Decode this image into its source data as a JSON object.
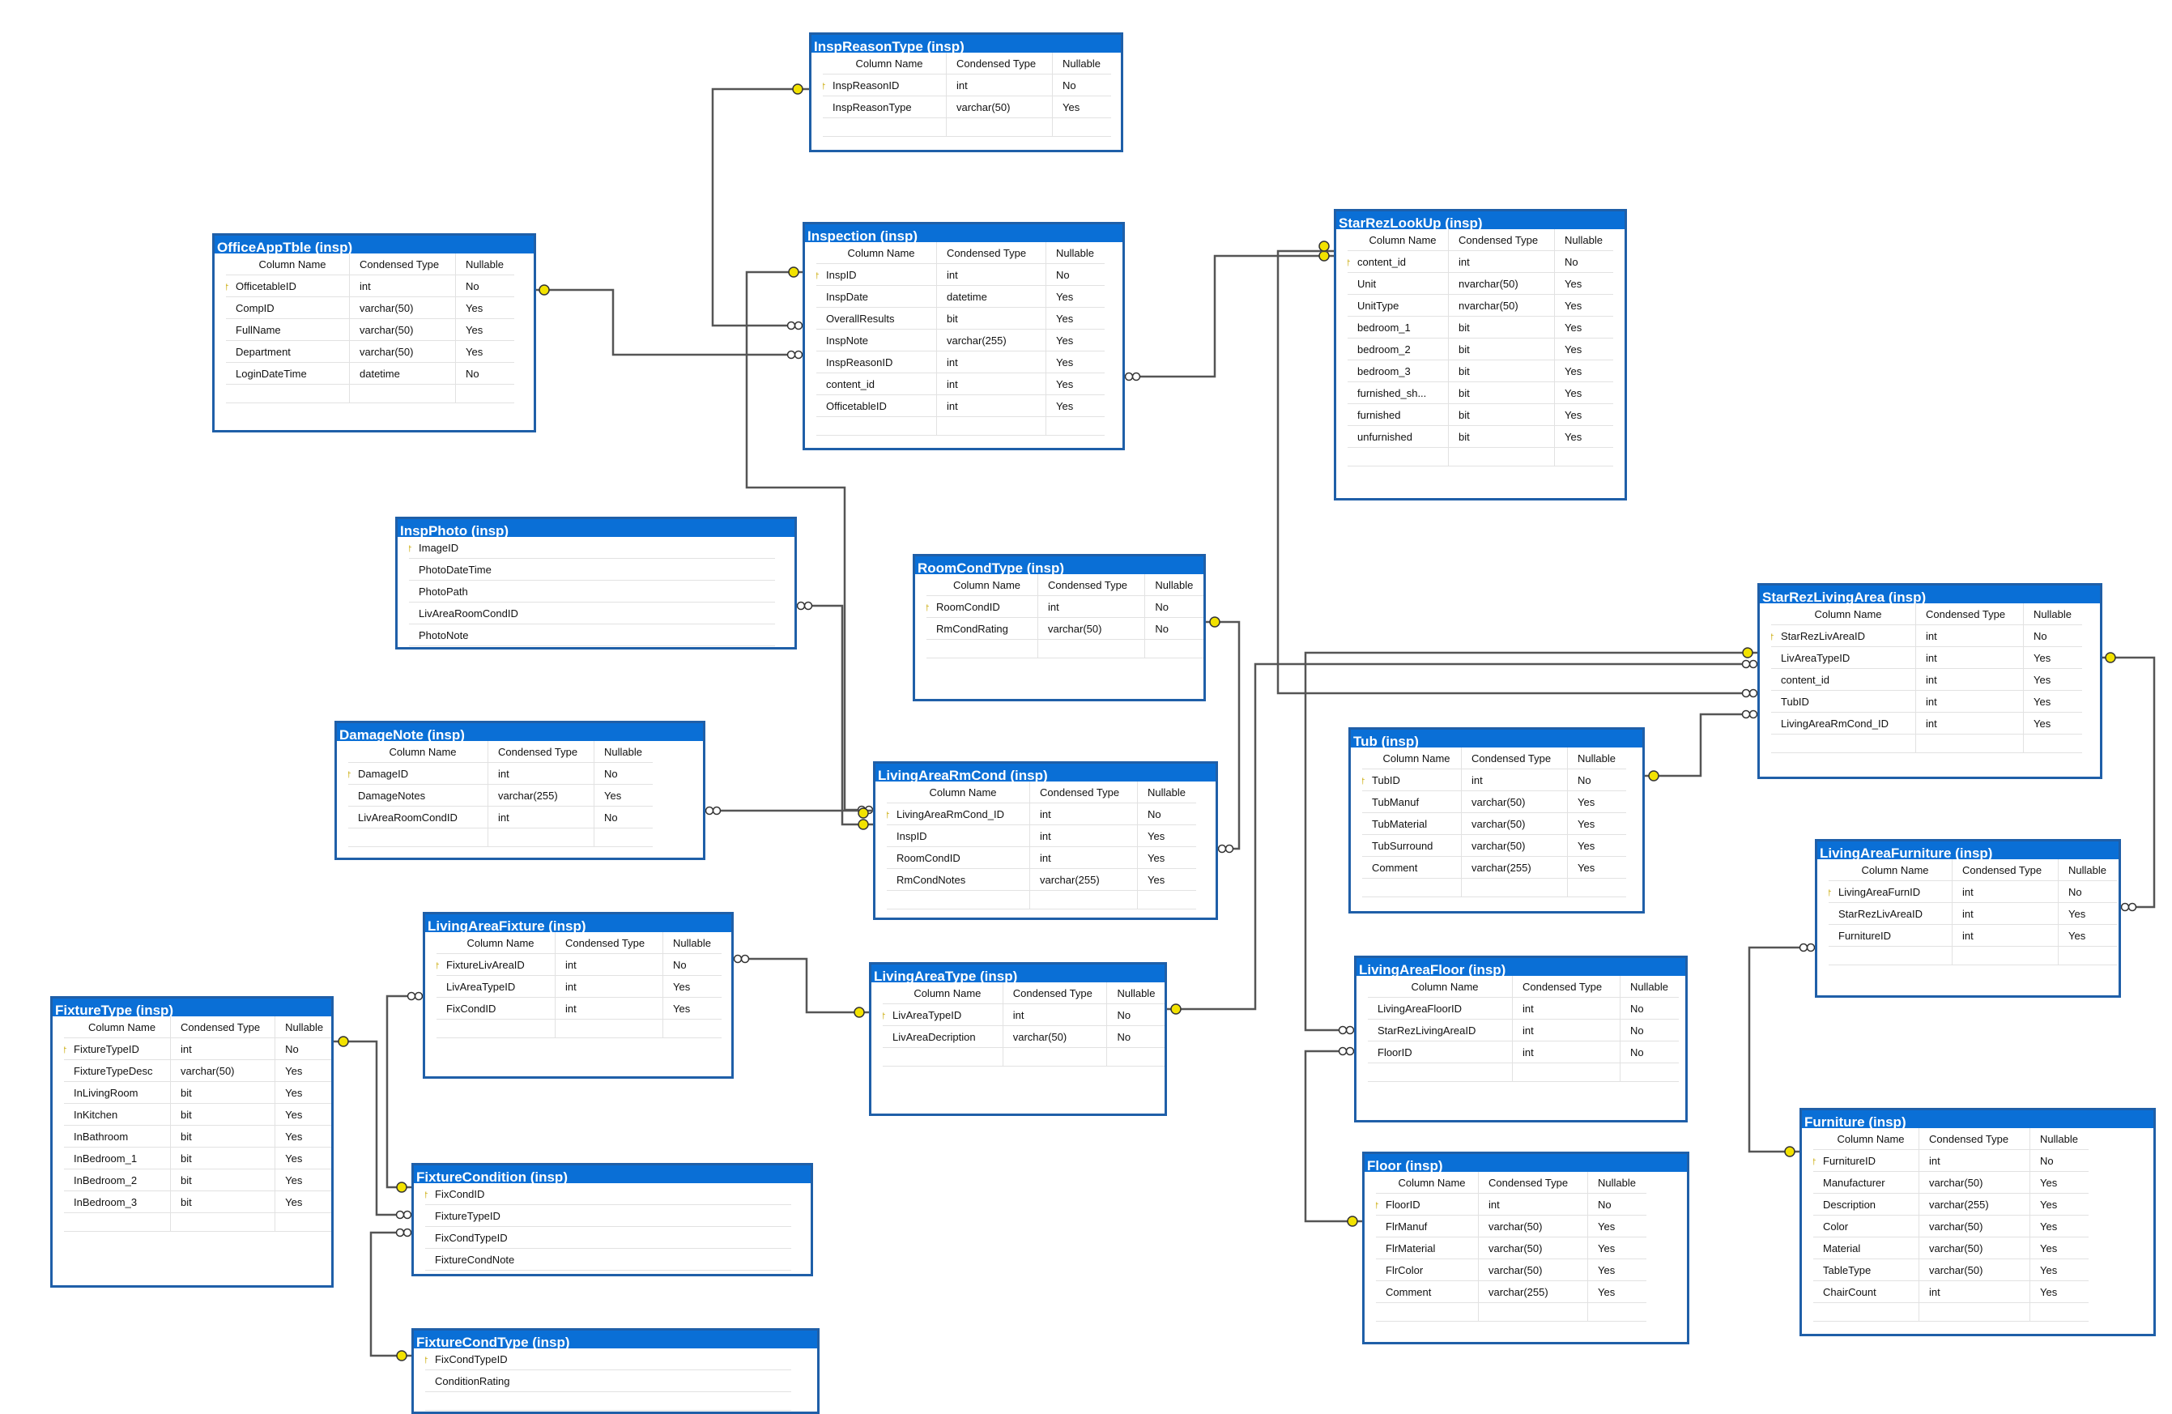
{
  "header_labels": [
    "Column Name",
    "Condensed Type",
    "Nullable"
  ],
  "tables": [
    {
      "id": "InspReasonType",
      "title": "InspReasonType (insp)",
      "columns": [
        {
          "name": "InspReasonID",
          "type": "int",
          "nullable": "No",
          "pk": true
        },
        {
          "name": "InspReasonType",
          "type": "varchar(50)",
          "nullable": "Yes"
        }
      ]
    },
    {
      "id": "Inspection",
      "title": "Inspection (insp)",
      "columns": [
        {
          "name": "InspID",
          "type": "int",
          "nullable": "No",
          "pk": true
        },
        {
          "name": "InspDate",
          "type": "datetime",
          "nullable": "Yes"
        },
        {
          "name": "OverallResults",
          "type": "bit",
          "nullable": "Yes"
        },
        {
          "name": "InspNote",
          "type": "varchar(255)",
          "nullable": "Yes"
        },
        {
          "name": "InspReasonID",
          "type": "int",
          "nullable": "Yes"
        },
        {
          "name": "content_id",
          "type": "int",
          "nullable": "Yes"
        },
        {
          "name": "OfficetableID",
          "type": "int",
          "nullable": "Yes"
        }
      ]
    },
    {
      "id": "OfficeAppTble",
      "title": "OfficeAppTble (insp)",
      "columns": [
        {
          "name": "OfficetableID",
          "type": "int",
          "nullable": "No",
          "pk": true
        },
        {
          "name": "CompID",
          "type": "varchar(50)",
          "nullable": "Yes"
        },
        {
          "name": "FullName",
          "type": "varchar(50)",
          "nullable": "Yes"
        },
        {
          "name": "Department",
          "type": "varchar(50)",
          "nullable": "Yes"
        },
        {
          "name": "LoginDateTime",
          "type": "datetime",
          "nullable": "No"
        }
      ]
    },
    {
      "id": "StarRezLookUp",
      "title": "StarRezLookUp (insp)",
      "columns": [
        {
          "name": "content_id",
          "type": "int",
          "nullable": "No",
          "pk": true
        },
        {
          "name": "Unit",
          "type": "nvarchar(50)",
          "nullable": "Yes"
        },
        {
          "name": "UnitType",
          "type": "nvarchar(50)",
          "nullable": "Yes"
        },
        {
          "name": "bedroom_1",
          "type": "bit",
          "nullable": "Yes"
        },
        {
          "name": "bedroom_2",
          "type": "bit",
          "nullable": "Yes"
        },
        {
          "name": "bedroom_3",
          "type": "bit",
          "nullable": "Yes"
        },
        {
          "name": "furnished_sh...",
          "type": "bit",
          "nullable": "Yes"
        },
        {
          "name": "furnished",
          "type": "bit",
          "nullable": "Yes"
        },
        {
          "name": "unfurnished",
          "type": "bit",
          "nullable": "Yes"
        }
      ]
    },
    {
      "id": "InspPhoto",
      "title": "InspPhoto (insp)",
      "single": true,
      "columns": [
        {
          "name": "ImageID",
          "pk": true
        },
        {
          "name": "PhotoDateTime"
        },
        {
          "name": "PhotoPath"
        },
        {
          "name": "LivAreaRoomCondID"
        },
        {
          "name": "PhotoNote"
        }
      ]
    },
    {
      "id": "RoomCondType",
      "title": "RoomCondType (insp)",
      "columns": [
        {
          "name": "RoomCondID",
          "type": "int",
          "nullable": "No",
          "pk": true
        },
        {
          "name": "RmCondRating",
          "type": "varchar(50)",
          "nullable": "No"
        }
      ]
    },
    {
      "id": "StarRezLivingArea",
      "title": "StarRezLivingArea (insp)",
      "columns": [
        {
          "name": "StarRezLivAreaID",
          "type": "int",
          "nullable": "No",
          "pk": true
        },
        {
          "name": "LivAreaTypeID",
          "type": "int",
          "nullable": "Yes"
        },
        {
          "name": "content_id",
          "type": "int",
          "nullable": "Yes"
        },
        {
          "name": "TubID",
          "type": "int",
          "nullable": "Yes"
        },
        {
          "name": "LivingAreaRmCond_ID",
          "type": "int",
          "nullable": "Yes"
        }
      ]
    },
    {
      "id": "DamageNote",
      "title": "DamageNote (insp)",
      "columns": [
        {
          "name": "DamageID",
          "type": "int",
          "nullable": "No",
          "pk": true
        },
        {
          "name": "DamageNotes",
          "type": "varchar(255)",
          "nullable": "Yes"
        },
        {
          "name": "LivAreaRoomCondID",
          "type": "int",
          "nullable": "No"
        }
      ]
    },
    {
      "id": "LivingAreaRmCond",
      "title": "LivingAreaRmCond (insp)",
      "columns": [
        {
          "name": "LivingAreaRmCond_ID",
          "type": "int",
          "nullable": "No",
          "pk": true
        },
        {
          "name": "InspID",
          "type": "int",
          "nullable": "Yes"
        },
        {
          "name": "RoomCondID",
          "type": "int",
          "nullable": "Yes"
        },
        {
          "name": "RmCondNotes",
          "type": "varchar(255)",
          "nullable": "Yes"
        }
      ]
    },
    {
      "id": "Tub",
      "title": "Tub (insp)",
      "columns": [
        {
          "name": "TubID",
          "type": "int",
          "nullable": "No",
          "pk": true
        },
        {
          "name": "TubManuf",
          "type": "varchar(50)",
          "nullable": "Yes"
        },
        {
          "name": "TubMaterial",
          "type": "varchar(50)",
          "nullable": "Yes"
        },
        {
          "name": "TubSurround",
          "type": "varchar(50)",
          "nullable": "Yes"
        },
        {
          "name": "Comment",
          "type": "varchar(255)",
          "nullable": "Yes"
        }
      ]
    },
    {
      "id": "LivingAreaFurniture",
      "title": "LivingAreaFurniture (insp)",
      "columns": [
        {
          "name": "LivingAreaFurnID",
          "type": "int",
          "nullable": "No",
          "pk": true
        },
        {
          "name": "StarRezLivAreaID",
          "type": "int",
          "nullable": "Yes"
        },
        {
          "name": "FurnitureID",
          "type": "int",
          "nullable": "Yes"
        }
      ]
    },
    {
      "id": "LivingAreaFixture",
      "title": "LivingAreaFixture (insp)",
      "columns": [
        {
          "name": "FixtureLivAreaID",
          "type": "int",
          "nullable": "No",
          "pk": true
        },
        {
          "name": "LivAreaTypeID",
          "type": "int",
          "nullable": "Yes"
        },
        {
          "name": "FixCondID",
          "type": "int",
          "nullable": "Yes"
        }
      ]
    },
    {
      "id": "LivingAreaType",
      "title": "LivingAreaType (insp)",
      "columns": [
        {
          "name": "LivAreaTypeID",
          "type": "int",
          "nullable": "No",
          "pk": true
        },
        {
          "name": "LivAreaDecription",
          "type": "varchar(50)",
          "nullable": "No"
        }
      ]
    },
    {
      "id": "LivingAreaFloor",
      "title": "LivingAreaFloor (insp)",
      "columns": [
        {
          "name": "LivingAreaFloorID",
          "type": "int",
          "nullable": "No"
        },
        {
          "name": "StarRezLivingAreaID",
          "type": "int",
          "nullable": "No"
        },
        {
          "name": "FloorID",
          "type": "int",
          "nullable": "No"
        }
      ]
    },
    {
      "id": "FixtureType",
      "title": "FixtureType (insp)",
      "columns": [
        {
          "name": "FixtureTypeID",
          "type": "int",
          "nullable": "No",
          "pk": true
        },
        {
          "name": "FixtureTypeDesc",
          "type": "varchar(50)",
          "nullable": "Yes"
        },
        {
          "name": "InLivingRoom",
          "type": "bit",
          "nullable": "Yes"
        },
        {
          "name": "InKitchen",
          "type": "bit",
          "nullable": "Yes"
        },
        {
          "name": "InBathroom",
          "type": "bit",
          "nullable": "Yes"
        },
        {
          "name": "InBedroom_1",
          "type": "bit",
          "nullable": "Yes"
        },
        {
          "name": "InBedroom_2",
          "type": "bit",
          "nullable": "Yes"
        },
        {
          "name": "InBedroom_3",
          "type": "bit",
          "nullable": "Yes"
        }
      ]
    },
    {
      "id": "FixtureCondition",
      "title": "FixtureCondition (insp)",
      "single": true,
      "columns": [
        {
          "name": "FixCondID",
          "pk": true
        },
        {
          "name": "FixtureTypeID"
        },
        {
          "name": "FixCondTypeID"
        },
        {
          "name": "FixtureCondNote"
        }
      ]
    },
    {
      "id": "Floor",
      "title": "Floor (insp)",
      "columns": [
        {
          "name": "FloorID",
          "type": "int",
          "nullable": "No",
          "pk": true
        },
        {
          "name": "FlrManuf",
          "type": "varchar(50)",
          "nullable": "Yes"
        },
        {
          "name": "FlrMaterial",
          "type": "varchar(50)",
          "nullable": "Yes"
        },
        {
          "name": "FlrColor",
          "type": "varchar(50)",
          "nullable": "Yes"
        },
        {
          "name": "Comment",
          "type": "varchar(255)",
          "nullable": "Yes"
        }
      ]
    },
    {
      "id": "Furniture",
      "title": "Furniture (insp)",
      "columns": [
        {
          "name": "FurnitureID",
          "type": "int",
          "nullable": "No",
          "pk": true
        },
        {
          "name": "Manufacturer",
          "type": "varchar(50)",
          "nullable": "Yes"
        },
        {
          "name": "Description",
          "type": "varchar(255)",
          "nullable": "Yes"
        },
        {
          "name": "Color",
          "type": "varchar(50)",
          "nullable": "Yes"
        },
        {
          "name": "Material",
          "type": "varchar(50)",
          "nullable": "Yes"
        },
        {
          "name": "TableType",
          "type": "varchar(50)",
          "nullable": "Yes"
        },
        {
          "name": "ChairCount",
          "type": "int",
          "nullable": "Yes"
        }
      ]
    },
    {
      "id": "FixtureCondType",
      "title": "FixtureCondType (insp)",
      "single": true,
      "columns": [
        {
          "name": "FixCondTypeID",
          "pk": true
        },
        {
          "name": "ConditionRating"
        }
      ]
    }
  ]
}
